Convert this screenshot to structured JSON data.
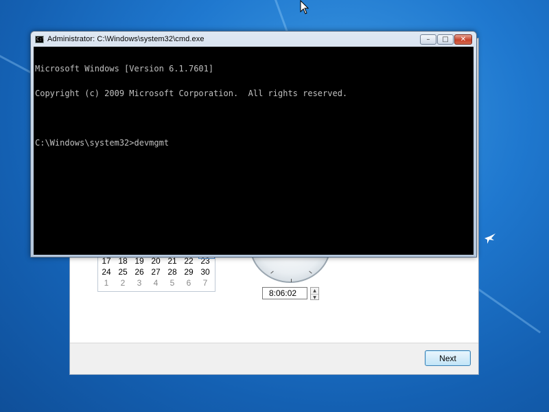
{
  "cmd_window": {
    "title": "Administrator: C:\\Windows\\system32\\cmd.exe",
    "icon": "cmd-icon",
    "icon_text": "C:\\",
    "lines": [
      "Microsoft Windows [Version 6.1.7601]",
      "Copyright (c) 2009 Microsoft Corporation.  All rights reserved.",
      "",
      "C:\\Windows\\system32>devmgmt"
    ],
    "buttons": {
      "minimize": "–",
      "maximize": "□",
      "close": "✕"
    }
  },
  "setup_window": {
    "calendar_rows": [
      [
        "17",
        "18",
        "19",
        "20",
        "21",
        "22",
        "23"
      ],
      [
        "24",
        "25",
        "26",
        "27",
        "28",
        "29",
        "30"
      ],
      [
        "1",
        "2",
        "3",
        "4",
        "5",
        "6",
        "7"
      ]
    ],
    "time": "8:06:02",
    "spinner_up": "▲",
    "spinner_down": "▼",
    "next_label": "Next"
  },
  "colors": {
    "desktop": "#1f78cf",
    "console_bg": "#000000",
    "console_text": "#c0c0c0"
  }
}
